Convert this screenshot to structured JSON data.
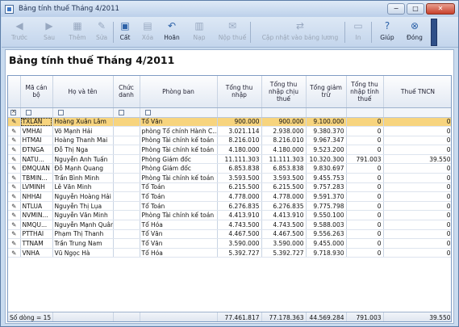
{
  "window": {
    "title": "Bảng tính thuế Tháng 4/2011",
    "min_label": "−",
    "max_label": "□",
    "close_label": "✕"
  },
  "toolbar": [
    {
      "label": "Trước",
      "icon": "arrow-left-icon",
      "glyph": "◀",
      "enabled": false
    },
    {
      "label": "Sau",
      "icon": "arrow-right-icon",
      "glyph": "▶",
      "enabled": false
    },
    {
      "label": "Thêm",
      "icon": "add-icon",
      "glyph": "▦",
      "enabled": false
    },
    {
      "label": "Sửa",
      "icon": "edit-icon",
      "glyph": "✎",
      "enabled": false
    },
    {
      "label": "Cất",
      "icon": "save-icon",
      "glyph": "▣",
      "enabled": true
    },
    {
      "label": "Xóa",
      "icon": "delete-icon",
      "glyph": "▤",
      "enabled": false
    },
    {
      "label": "Hoãn",
      "icon": "undo-icon",
      "glyph": "↶",
      "enabled": true
    },
    {
      "label": "Nạp",
      "icon": "reload-icon",
      "glyph": "▥",
      "enabled": false
    },
    {
      "label": "Nộp thuế",
      "icon": "pay-tax-icon",
      "glyph": "✉",
      "enabled": false
    },
    {
      "label": "Cập nhật vào bảng lương",
      "icon": "update-payroll-icon",
      "glyph": "⇄",
      "enabled": false
    },
    {
      "label": "In",
      "icon": "print-icon",
      "glyph": "▭",
      "enabled": false
    },
    {
      "label": "Giúp",
      "icon": "help-icon",
      "glyph": "?",
      "enabled": true
    },
    {
      "label": "Đóng",
      "icon": "close-icon",
      "glyph": "⊗",
      "enabled": true
    }
  ],
  "page_title": "Bảng tính thuế Tháng 4/2011",
  "columns": [
    "Mã cán bộ",
    "Họ và tên",
    "Chức danh",
    "Phòng ban",
    "Tổng thu nhập",
    "Tổng thu nhập chịu thuế",
    "Tổng giảm trừ",
    "Tổng thu nhập tính thuế",
    "Thuế TNCN"
  ],
  "rows": [
    {
      "code": "TXLAN",
      "name": "Hoàng Xuân Lâm",
      "title": "",
      "dept": "Tổ Văn",
      "income": "900.000",
      "taxable": "900.000",
      "deduction": "9.100.000",
      "assessable": "0",
      "tax": "0",
      "selected": true
    },
    {
      "code": "VMHAI",
      "name": "Võ Mạnh Hải",
      "title": "",
      "dept": "phòng Tổ chính Hành C...",
      "income": "3.021.114",
      "taxable": "2.938.000",
      "deduction": "9.380.370",
      "assessable": "0",
      "tax": "0"
    },
    {
      "code": "HTMAI",
      "name": "Hoàng Thanh Mai",
      "title": "",
      "dept": "Phòng Tài chính kế toán",
      "income": "8.216.010",
      "taxable": "8.216.010",
      "deduction": "9.967.347",
      "assessable": "0",
      "tax": "0"
    },
    {
      "code": "ĐTNGA",
      "name": "Đỗ Thị Nga",
      "title": "",
      "dept": "Phòng Tài chính kế toán",
      "income": "4.180.000",
      "taxable": "4.180.000",
      "deduction": "9.523.200",
      "assessable": "0",
      "tax": "0"
    },
    {
      "code": "NATU...",
      "name": "Nguyễn Anh Tuấn",
      "title": "",
      "dept": "Phòng Giám đốc",
      "income": "11.111.303",
      "taxable": "11.111.303",
      "deduction": "10.320.300",
      "assessable": "791.003",
      "tax": "39.550"
    },
    {
      "code": "ĐMQUAN",
      "name": "Đỗ Mạnh Quang",
      "title": "",
      "dept": "Phòng Giám đốc",
      "income": "6.853.838",
      "taxable": "6.853.838",
      "deduction": "9.830.697",
      "assessable": "0",
      "tax": "0"
    },
    {
      "code": "TBMIN...",
      "name": "Trần Bình Minh",
      "title": "",
      "dept": "Phòng Tài chính kế toán",
      "income": "3.593.500",
      "taxable": "3.593.500",
      "deduction": "9.455.753",
      "assessable": "0",
      "tax": "0"
    },
    {
      "code": "LVMINH",
      "name": "Lê Văn Minh",
      "title": "",
      "dept": "Tổ Toán",
      "income": "6.215.500",
      "taxable": "6.215.500",
      "deduction": "9.757.283",
      "assessable": "0",
      "tax": "0"
    },
    {
      "code": "NHHAI",
      "name": "Nguyễn Hoàng Hải",
      "title": "",
      "dept": "Tổ Toán",
      "income": "4.778.000",
      "taxable": "4.778.000",
      "deduction": "9.591.370",
      "assessable": "0",
      "tax": "0"
    },
    {
      "code": "NTLUA",
      "name": "Nguyễn Thị Lụa",
      "title": "",
      "dept": "Tổ Toán",
      "income": "6.276.835",
      "taxable": "6.276.835",
      "deduction": "9.775.798",
      "assessable": "0",
      "tax": "0"
    },
    {
      "code": "NVMIN...",
      "name": "Nguyễn Văn Minh",
      "title": "",
      "dept": "Phòng Tài chính kế toán",
      "income": "4.413.910",
      "taxable": "4.413.910",
      "deduction": "9.550.100",
      "assessable": "0",
      "tax": "0"
    },
    {
      "code": "NMQU...",
      "name": "Nguyễn Mạnh Quân",
      "title": "",
      "dept": "Tổ Hóa",
      "income": "4.743.500",
      "taxable": "4.743.500",
      "deduction": "9.588.003",
      "assessable": "0",
      "tax": "0"
    },
    {
      "code": "PTTHAI",
      "name": "Phạm Thị Thanh",
      "title": "",
      "dept": "Tổ Văn",
      "income": "4.467.500",
      "taxable": "4.467.500",
      "deduction": "9.556.263",
      "assessable": "0",
      "tax": "0"
    },
    {
      "code": "TTNAM",
      "name": "Trần Trung Nam",
      "title": "",
      "dept": "Tổ Văn",
      "income": "3.590.000",
      "taxable": "3.590.000",
      "deduction": "9.455.000",
      "assessable": "0",
      "tax": "0"
    },
    {
      "code": "VNHA",
      "name": "Vũ Ngọc Hà",
      "title": "",
      "dept": "Tổ Hóa",
      "income": "5.392.727",
      "taxable": "5.392.727",
      "deduction": "9.718.930",
      "assessable": "0",
      "tax": "0"
    }
  ],
  "footer": {
    "row_count": "Số dòng = 15",
    "total_income": "77.461.817",
    "total_taxable": "77.178.363",
    "total_deduction": "44.569.284",
    "total_assessable": "791.003",
    "total_tax": "39.550"
  }
}
